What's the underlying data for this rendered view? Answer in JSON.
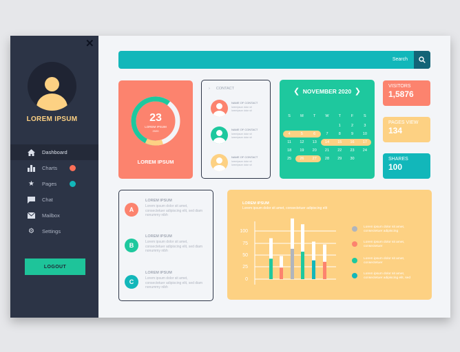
{
  "sidebar": {
    "username": "LOREM IPSUM",
    "items": [
      {
        "label": "Dashboard",
        "icon": "home-icon"
      },
      {
        "label": "Charts",
        "icon": "bar-chart-icon",
        "dot": "#fc6f57"
      },
      {
        "label": "Pages",
        "icon": "star-icon",
        "dot": "#12b7ba"
      },
      {
        "label": "Chat",
        "icon": "chat-icon"
      },
      {
        "label": "Mailbox",
        "icon": "mail-icon"
      },
      {
        "label": "Settings",
        "icon": "gear-icon"
      }
    ],
    "logout": "LOGOUT"
  },
  "search": {
    "label": "Search"
  },
  "progress": {
    "value": "23",
    "line1": "LOREM IPSUM",
    "line2": "2020",
    "label": "LOREM IPSUM",
    "fraction": 0.6
  },
  "contact": {
    "title": "CONTACT",
    "items": [
      {
        "name": "NAME OF CONTACT",
        "l1": "loremipsum dolor sit",
        "l2": "loremipsum dolor sit",
        "color": "#fc836e"
      },
      {
        "name": "NAME OF CONTACT",
        "l1": "loremipsum dolor sit",
        "l2": "loremipsum dolor sit",
        "color": "#1ec89e"
      },
      {
        "name": "NAME OF CONTACT",
        "l1": "loremipsum dolor sit",
        "l2": "loremipsum dolor sit",
        "color": "#fdd183"
      }
    ]
  },
  "calendar": {
    "month": "NOVEMBER 2020",
    "weekdays": [
      "S",
      "M",
      "T",
      "W",
      "T",
      "F",
      "S"
    ],
    "days": [
      "",
      "",
      "",
      "",
      "1",
      "2",
      "3",
      "4",
      "5",
      "6",
      "7",
      "8",
      "9",
      "10",
      "11",
      "12",
      "13",
      "14",
      "15",
      "16",
      "17",
      "18",
      "19",
      "20",
      "21",
      "22",
      "23",
      "24",
      "25",
      "26",
      "27",
      "28",
      "29",
      "30",
      ""
    ],
    "highlighted": [
      "4",
      "5",
      "6",
      "14",
      "15",
      "16",
      "17",
      "26",
      "27"
    ]
  },
  "stats": [
    {
      "label": "VISITORS",
      "value": "1,5876",
      "color": "#fc836e"
    },
    {
      "label": "PAGES VIEW",
      "value": "134",
      "color": "#fdd183"
    },
    {
      "label": "SHARES",
      "value": "100",
      "color": "#12b7ba"
    }
  ],
  "list": [
    {
      "letter": "A",
      "title": "LOREM IPSUM",
      "text": "Lorem ipsum dolor sit amet, consectetuer adipiscing elit, sed diam nonummy nibh",
      "color": "#fc836e"
    },
    {
      "letter": "B",
      "title": "LOREM IPSUM",
      "text": "Lorem ipsum dolor sit amet, consectetuer adipiscing elit, sed diam nonummy nibh",
      "color": "#1ec89e"
    },
    {
      "letter": "C",
      "title": "LOREM IPSUM",
      "text": "Lorem ipsum dolor sit amet, consectetuer adipiscing elit, sed diam nonummy nibh",
      "color": "#12b7ba"
    }
  ],
  "chart": {
    "title": "LOREM IPSUM",
    "subtitle": "Lorem ipsum dolor sit amet, consectetuer adipiscing elit",
    "legend": [
      {
        "text": "Lorem ipsum dolor sit amet, consectetuer adipiscing",
        "color": "#b0b5bd"
      },
      {
        "text": "Lorem ipsum dolor sit amet, consectetuer",
        "color": "#fc836e"
      },
      {
        "text": "Lorem ipsum dolor sit amet, consectetuer",
        "color": "#1ec89e"
      },
      {
        "text": "Lorem ipsum dolor sit amet, consectetuer adipiscing elit, sed",
        "color": "#12b7ba"
      }
    ]
  },
  "chart_data": {
    "type": "bar",
    "yticks": [
      "100",
      "75",
      "50",
      "25",
      "0"
    ],
    "ylim": [
      0,
      100
    ],
    "bars": [
      {
        "value": 85,
        "color": "#1ec89e"
      },
      {
        "value": 48,
        "color": "#fc836e"
      },
      {
        "value": 126,
        "color": "#b0b5bd"
      },
      {
        "value": 114,
        "color": "#1ec89e"
      },
      {
        "value": 78,
        "color": "#12b7ba"
      },
      {
        "value": 72,
        "color": "#fc836e"
      }
    ],
    "fill_fraction": 0.5
  }
}
